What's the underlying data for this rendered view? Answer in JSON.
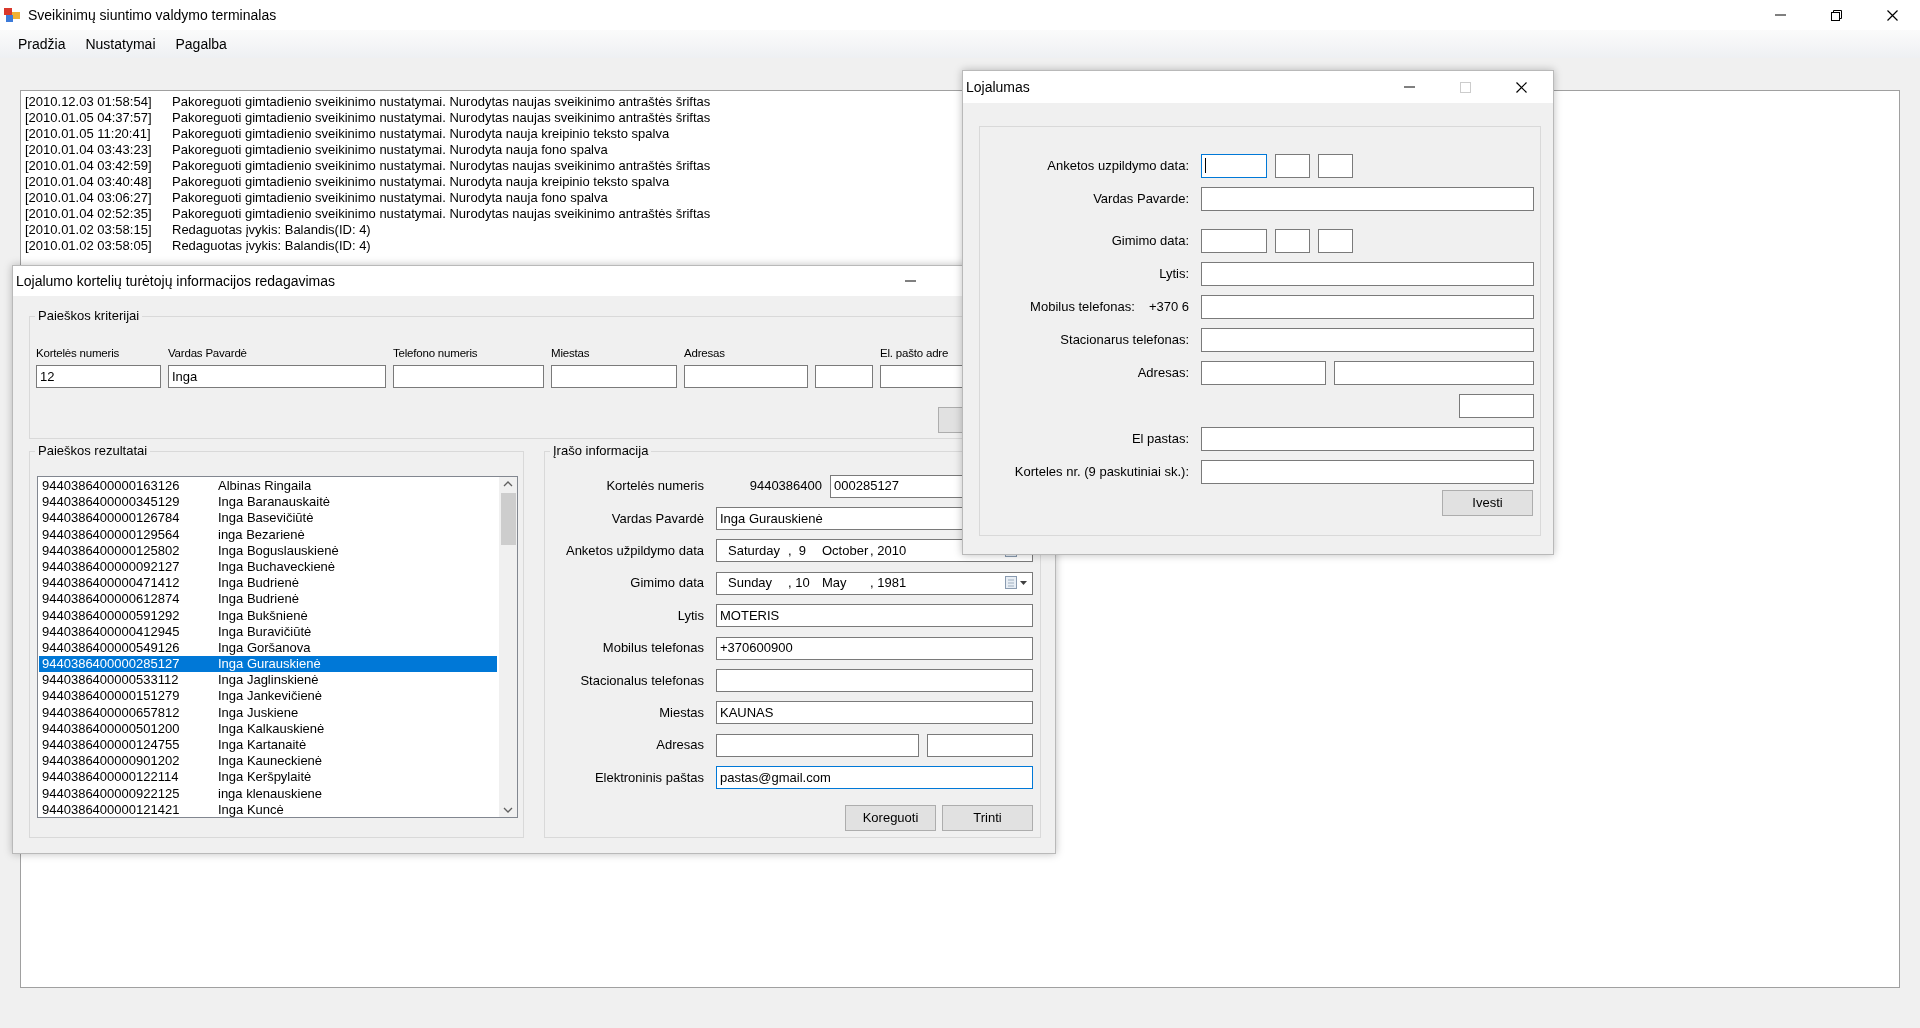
{
  "window": {
    "title": "Sveikinimų siuntimo valdymo terminalas"
  },
  "menu": [
    {
      "label": "Pradžia"
    },
    {
      "label": "Nustatymai"
    },
    {
      "label": "Pagalba"
    }
  ],
  "log": [
    {
      "time": "[2010.12.03 01:58:54]",
      "message": "Pakoreguoti gimtadienio sveikinimo nustatymai. Nurodytas naujas sveikinimo antraštės šriftas"
    },
    {
      "time": "[2010.01.05 04:37:57]",
      "message": "Pakoreguoti gimtadienio sveikinimo nustatymai. Nurodytas naujas sveikinimo antraštės šriftas"
    },
    {
      "time": "[2010.01.05 11:20:41]",
      "message": "Pakoreguoti gimtadienio sveikinimo nustatymai. Nurodyta nauja kreipinio teksto spalva"
    },
    {
      "time": "[2010.01.04 03:43:23]",
      "message": "Pakoreguoti gimtadienio sveikinimo nustatymai. Nurodyta nauja fono spalva"
    },
    {
      "time": "[2010.01.04 03:42:59]",
      "message": "Pakoreguoti gimtadienio sveikinimo nustatymai. Nurodytas naujas sveikinimo antraštės šriftas"
    },
    {
      "time": "[2010.01.04 03:40:48]",
      "message": "Pakoreguoti gimtadienio sveikinimo nustatymai. Nurodyta nauja kreipinio teksto spalva"
    },
    {
      "time": "[2010.01.04 03:06:27]",
      "message": "Pakoreguoti gimtadienio sveikinimo nustatymai. Nurodyta nauja fono spalva"
    },
    {
      "time": "[2010.01.04 02:52:35]",
      "message": "Pakoreguoti gimtadienio sveikinimo nustatymai. Nurodytas naujas sveikinimo antraštės šriftas"
    },
    {
      "time": "[2010.01.02 03:58:15]",
      "message": "Redaguotas įvykis: Balandis(ID: 4)"
    },
    {
      "time": "[2010.01.02 03:58:05]",
      "message": "Redaguotas įvykis: Balandis(ID: 4)"
    }
  ],
  "editor_window": {
    "title": "Lojalumo kortelių turėtojų informacijos redagavimas",
    "search": {
      "legend": "Paieškos kriterijai",
      "fields": [
        {
          "kind": "labeled",
          "label": "Kortelės numeris",
          "value": "12"
        },
        {
          "kind": "labeled",
          "label": "Vardas Pavardė",
          "value": "Inga"
        },
        {
          "kind": "labeled",
          "label": "Telefono numeris"
        },
        {
          "kind": "labeled",
          "label": "Miestas"
        },
        {
          "kind": "labeled",
          "label": "Adresas"
        },
        {
          "kind": "unlabeled"
        },
        {
          "kind": "labeled",
          "label": "El. pašto adre"
        }
      ]
    },
    "results": {
      "legend": "Paieškos rezultatai",
      "rows": [
        {
          "card": "9440386400000163126",
          "name": "Albinas Ringaila",
          "selected": false
        },
        {
          "card": "9440386400000345129",
          "name": "Inga Baranauskaitė",
          "selected": false
        },
        {
          "card": "9440386400000126784",
          "name": "Inga Basevičiūtė",
          "selected": false
        },
        {
          "card": "9440386400000129564",
          "name": "inga Bezarienė",
          "selected": false
        },
        {
          "card": "9440386400000125802",
          "name": "Inga Boguslauskienė",
          "selected": false
        },
        {
          "card": "9440386400000092127",
          "name": "Inga Buchaveckienė",
          "selected": false
        },
        {
          "card": "9440386400000471412",
          "name": "Inga Budrienė",
          "selected": false
        },
        {
          "card": "9440386400000612874",
          "name": "Inga Budrienė",
          "selected": false
        },
        {
          "card": "9440386400000591292",
          "name": "Inga Bukšnienė",
          "selected": false
        },
        {
          "card": "9440386400000412945",
          "name": "Inga Buravičiūtė",
          "selected": false
        },
        {
          "card": "9440386400000549126",
          "name": "Inga Goršanova",
          "selected": false
        },
        {
          "card": "9440386400000285127",
          "name": "Inga Gurauskienė",
          "selected": true
        },
        {
          "card": "9440386400000533112",
          "name": "Inga Jaglinskienė",
          "selected": false
        },
        {
          "card": "9440386400000151279",
          "name": "Inga Jankevičienė",
          "selected": false
        },
        {
          "card": "9440386400000657812",
          "name": "Inga Juskiene",
          "selected": false
        },
        {
          "card": "9440386400000501200",
          "name": "Inga Kalkauskienė",
          "selected": false
        },
        {
          "card": "9440386400000124755",
          "name": "Inga Kartanaitė",
          "selected": false
        },
        {
          "card": "9440386400000901202",
          "name": "Inga Kauneckienė",
          "selected": false
        },
        {
          "card": "9440386400000122114",
          "name": "Inga Keršpylaitė",
          "selected": false
        },
        {
          "card": "9440386400000922125",
          "name": "inga klenauskiene",
          "selected": false
        },
        {
          "card": "9440386400000121421",
          "name": "Inga Kuncė",
          "selected": false
        }
      ]
    },
    "record": {
      "legend": "Įrašo informacija",
      "rows": [
        {
          "kind": "card",
          "label": "Kortelės numeris",
          "prefix": "9440386400",
          "value": "000285127",
          "focused": false
        },
        {
          "kind": "text",
          "label": "Vardas Pavardė",
          "value": "Inga Gurauskienė",
          "focused": false
        },
        {
          "kind": "date",
          "label": "Anketos užpildymo data",
          "parts": [
            "Saturday",
            ",  9",
            "October",
            ", 2010"
          ],
          "focused": false
        },
        {
          "kind": "date",
          "label": "Gimimo data",
          "parts": [
            "Sunday",
            ", 10",
            "May",
            ", 1981"
          ],
          "focused": false
        },
        {
          "kind": "text",
          "label": "Lytis",
          "value": "MOTERIS",
          "focused": false
        },
        {
          "kind": "text",
          "label": "Mobilus telefonas",
          "value": "+370600900",
          "focused": false
        },
        {
          "kind": "text",
          "label": "Stacionalus telefonas",
          "focused": false
        },
        {
          "kind": "text",
          "label": "Miestas",
          "value": "KAUNAS",
          "focused": false
        },
        {
          "kind": "address",
          "label": "Adresas",
          "focused": false
        },
        {
          "kind": "text",
          "label": "Elektroninis paštas",
          "value": "pastas@gmail.com",
          "focused": true
        }
      ],
      "buttons": [
        "Koreguoti",
        "Trinti"
      ]
    }
  },
  "dialog": {
    "title": "Lojalumas",
    "rows": [
      {
        "kind": "date",
        "label": "Anketos uzpildymo data:",
        "focused": true
      },
      {
        "kind": "text",
        "label": "Vardas Pavarde:",
        "focused": false
      },
      {
        "kind": "date",
        "label": "Gimimo data:",
        "focused": false
      },
      {
        "kind": "text",
        "label": "Lytis:",
        "focused": false
      },
      {
        "kind": "text",
        "label": "Mobilus telefonas:",
        "prefix": "+370 6",
        "focused": false
      },
      {
        "kind": "text",
        "label": "Stacionarus telefonas:",
        "focused": false
      },
      {
        "kind": "address",
        "label": "Adresas:",
        "focused": false
      },
      {
        "kind": "text",
        "label": "El pastas:",
        "focused": false
      },
      {
        "kind": "text",
        "label": "Korteles nr. (9 paskutiniai sk.):",
        "focused": false
      }
    ],
    "button": "Ivesti"
  }
}
